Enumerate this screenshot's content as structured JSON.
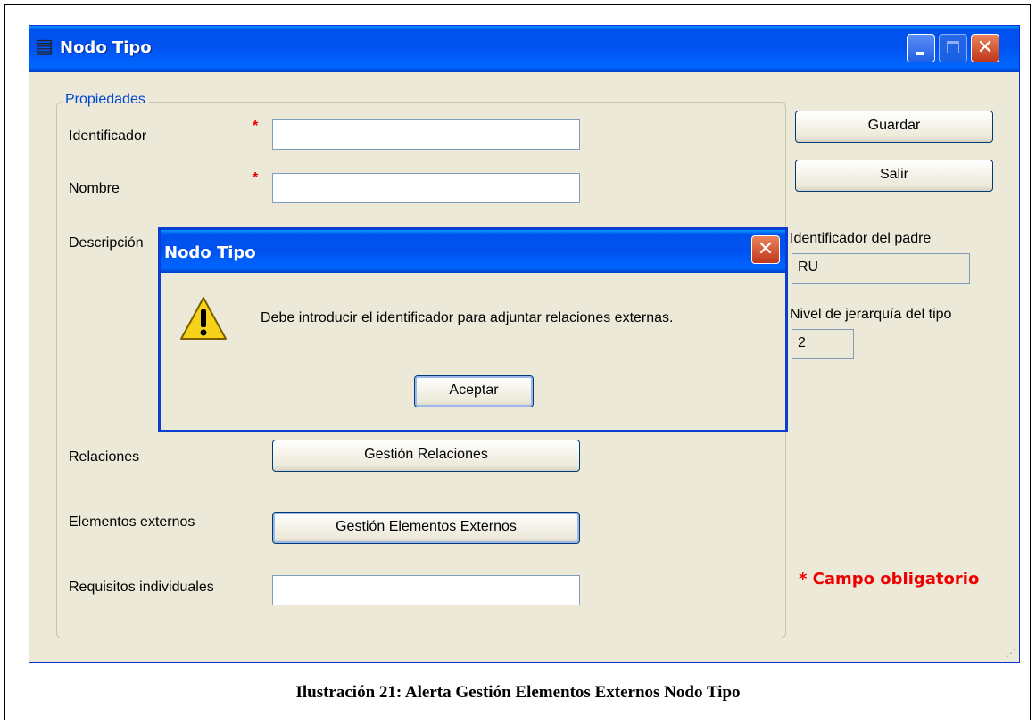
{
  "window": {
    "title": "Nodo Tipo"
  },
  "form": {
    "group_title": "Propiedades",
    "required_mark": "*",
    "identificador_label": "Identificador",
    "identificador_value": "",
    "nombre_label": "Nombre",
    "nombre_value": "",
    "descripcion_label": "Descripción",
    "relaciones_label": "Relaciones",
    "relaciones_button": "Gestión Relaciones",
    "elementos_label": "Elementos externos",
    "elementos_button": "Gestión Elementos Externos",
    "requisitos_label": "Requisitos individuales",
    "requisitos_value": ""
  },
  "side": {
    "guardar_button": "Guardar",
    "salir_button": "Salir",
    "padre_label": "Identificador del padre",
    "padre_value": "RU",
    "nivel_label": "Nivel de jerarquía del tipo",
    "nivel_value": "2",
    "required_note": "* Campo obligatorio"
  },
  "dialog": {
    "title": "Nodo Tipo",
    "message": "Debe introducir el identificador para adjuntar relaciones externas.",
    "ok_button": "Aceptar",
    "icon": "warning-icon"
  },
  "caption": "Ilustración 21: Alerta Gestión Elementos Externos Nodo Tipo"
}
